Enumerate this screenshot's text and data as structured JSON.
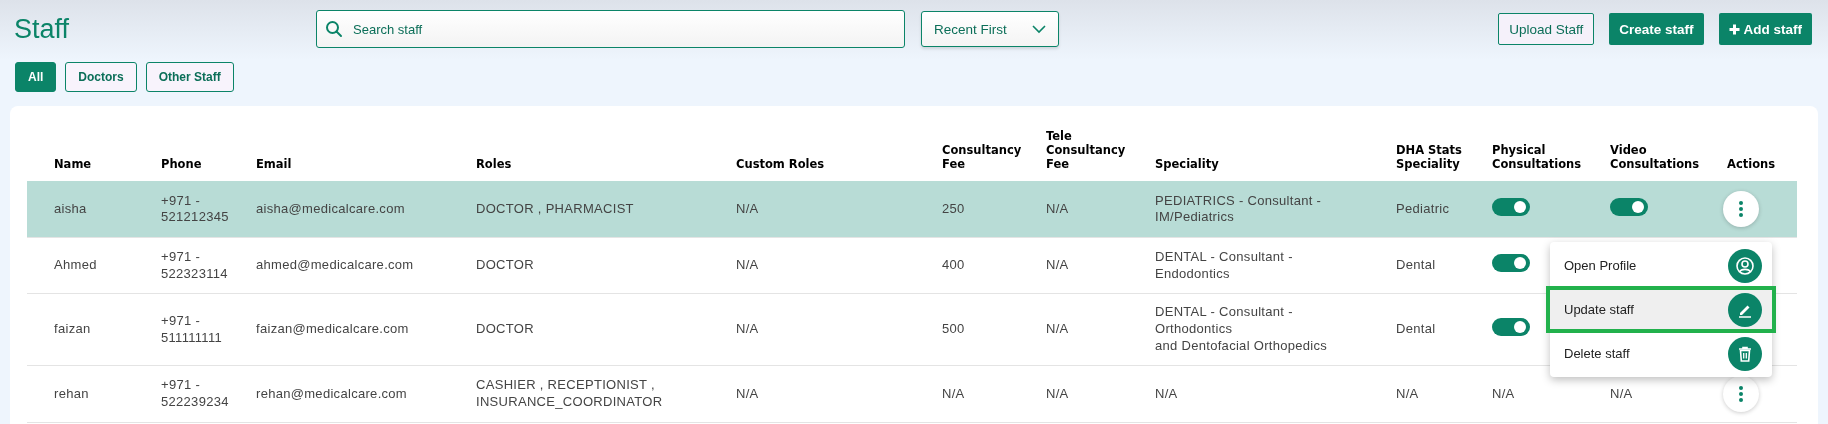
{
  "page": {
    "title": "Staff"
  },
  "search": {
    "placeholder": "Search staff"
  },
  "sort": {
    "value": "Recent First"
  },
  "buttons": [
    {
      "label": "Upload Staff",
      "kind": "outline"
    },
    {
      "label": "Create staff",
      "kind": "primary"
    },
    {
      "label": "Add staff",
      "kind": "add"
    }
  ],
  "filters": [
    {
      "label": "All",
      "selected": true
    },
    {
      "label": "Doctors",
      "selected": false
    },
    {
      "label": "Other Staff",
      "selected": false
    }
  ],
  "table": {
    "columns": [
      "Name",
      "Phone",
      "Email",
      "Roles",
      "Custom Roles",
      "Consultancy Fee",
      "Tele Consultancy Fee",
      "Speciality",
      "DHA Stats Speciality",
      "Physical Consultations",
      "Video Consultations",
      "Actions"
    ],
    "rows": [
      {
        "selected": true,
        "name": "aisha",
        "phone": [
          "+971 -",
          "521212345"
        ],
        "email": "aisha@medicalcare.com",
        "roles": [
          "DOCTOR , PHARMACIST"
        ],
        "custom_roles": "N/A",
        "fee": "250",
        "tele_fee": "N/A",
        "speciality": [
          "PEDIATRICS - Consultant -",
          "IM/Pediatrics"
        ],
        "dha": "Pediatric",
        "physical": {
          "kind": "toggle",
          "on": true
        },
        "video": {
          "kind": "toggle",
          "on": true
        },
        "actions": true
      },
      {
        "selected": false,
        "name": "Ahmed",
        "phone": [
          "+971 -",
          "522323114"
        ],
        "email": "ahmed@medicalcare.com",
        "roles": [
          "DOCTOR"
        ],
        "custom_roles": "N/A",
        "fee": "400",
        "tele_fee": "N/A",
        "speciality": [
          "DENTAL - Consultant -",
          "Endodontics"
        ],
        "dha": "Dental",
        "physical": {
          "kind": "toggle",
          "on": true
        },
        "actions": false
      },
      {
        "selected": false,
        "name": "faizan",
        "phone": [
          "+971 -",
          "511111111"
        ],
        "email": "faizan@medicalcare.com",
        "roles": [
          "DOCTOR"
        ],
        "custom_roles": "N/A",
        "fee": "500",
        "tele_fee": "N/A",
        "speciality": [
          "DENTAL - Consultant -",
          "Orthodontics",
          "and Dentofacial Orthopedics"
        ],
        "dha": "Dental",
        "physical": {
          "kind": "toggle",
          "on": true
        },
        "actions": false
      },
      {
        "selected": false,
        "name": "rehan",
        "phone": [
          "+971 -",
          "522239234"
        ],
        "email": "rehan@medicalcare.com",
        "roles": [
          "CASHIER , RECEPTIONIST ,",
          "INSURANCE_COORDINATOR"
        ],
        "custom_roles": "N/A",
        "fee": "N/A",
        "tele_fee": "N/A",
        "speciality": [
          "N/A"
        ],
        "dha": "N/A",
        "physical": {
          "kind": "text",
          "text": "N/A"
        },
        "video": {
          "kind": "text",
          "text": "N/A"
        },
        "actions": true
      }
    ]
  },
  "action_menu": {
    "items": [
      {
        "label": "Open Profile",
        "kind": "profile",
        "selected": false
      },
      {
        "label": "Update staff",
        "kind": "edit",
        "selected": true
      },
      {
        "label": "Delete staff",
        "kind": "delete",
        "selected": false
      }
    ]
  }
}
